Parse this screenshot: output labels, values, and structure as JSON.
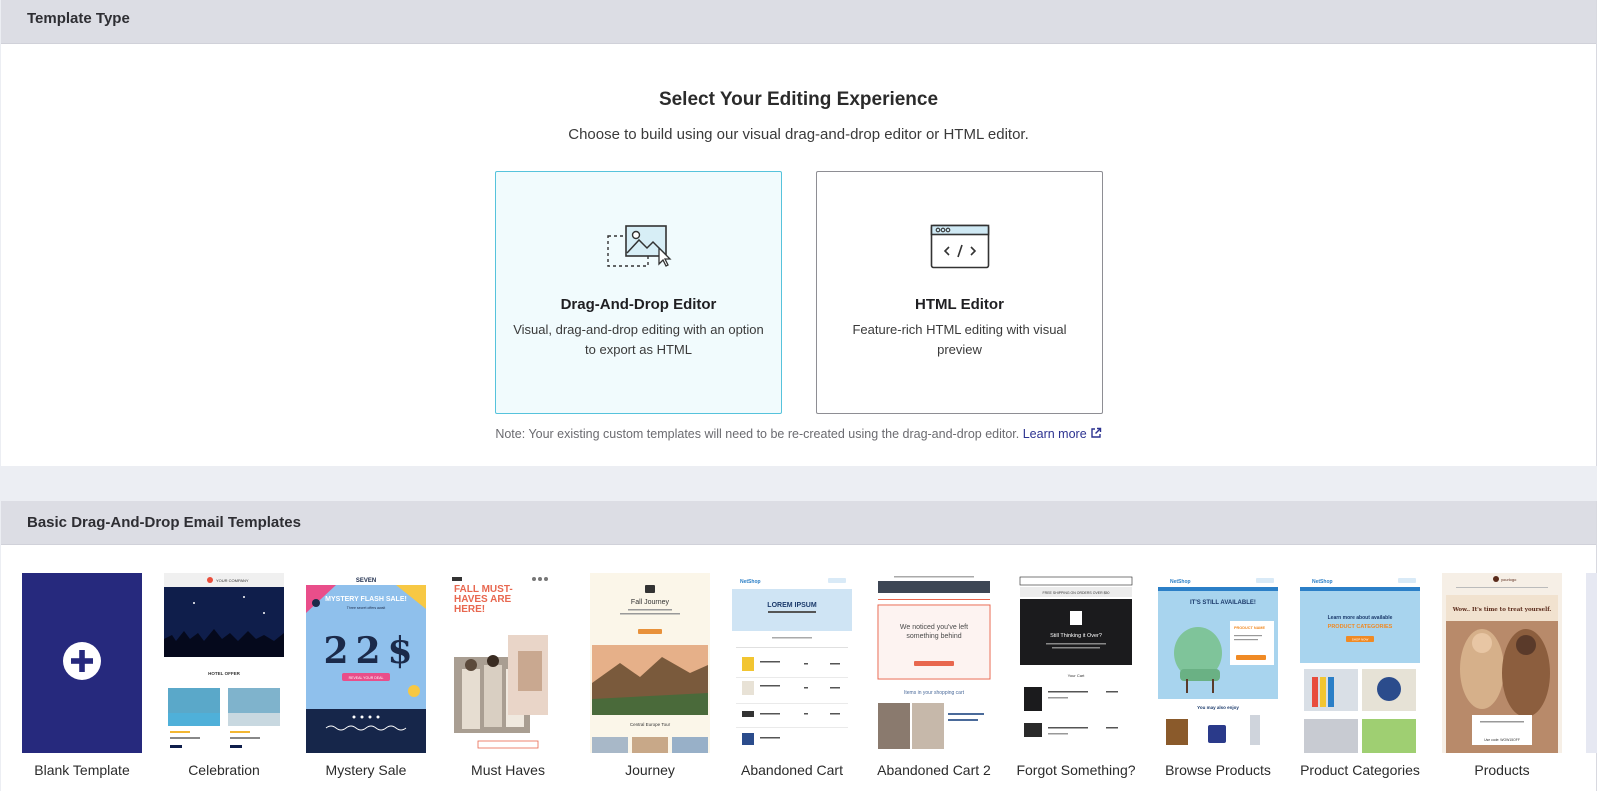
{
  "template_type": {
    "heading": "Template Type"
  },
  "editing": {
    "title": "Select Your Editing Experience",
    "subtitle": "Choose to build using our visual drag-and-drop editor or HTML editor.",
    "options": [
      {
        "title": "Drag-And-Drop Editor",
        "description": "Visual, drag-and-drop editing with an option to export as HTML",
        "selected": true
      },
      {
        "title": "HTML Editor",
        "description": "Feature-rich HTML editing with visual preview",
        "selected": false
      }
    ],
    "note": "Note: Your existing custom templates will need to be re-created using the drag-and-drop editor.",
    "learn_more": "Learn more"
  },
  "basic_templates": {
    "heading": "Basic Drag-And-Drop Email Templates",
    "items": [
      {
        "label": "Blank Template"
      },
      {
        "label": "Celebration",
        "thumb_text": [
          "YOUR COMPANY",
          "HOTEL OFFER"
        ]
      },
      {
        "label": "Mystery Sale",
        "thumb_text": [
          "SEVEN",
          "MYSTERY FLASH SALE!",
          "Three secret offers await",
          "REVEAL YOUR DEAL"
        ]
      },
      {
        "label": "Must Haves",
        "thumb_text": [
          "FALL MUST-HAVES ARE HERE!"
        ]
      },
      {
        "label": "Journey",
        "thumb_text": [
          "Fall Journey",
          "Central Europe Tour"
        ]
      },
      {
        "label": "Abandoned Cart",
        "thumb_text": [
          "NetShop",
          "LOREM IPSUM"
        ]
      },
      {
        "label": "Abandoned Cart 2",
        "thumb_text": [
          "We noticed you've left something behind",
          "Items in your shopping cart"
        ]
      },
      {
        "label": "Forgot Something?",
        "thumb_text": [
          "FREE SHIPPING ON ORDERS OVER $50",
          "Still Thinking it Over?",
          "Your Cart"
        ]
      },
      {
        "label": "Browse Products",
        "thumb_text": [
          "NetShop",
          "IT'S STILL AVAILABLE!",
          "PRODUCT NAME",
          "You may also enjoy"
        ]
      },
      {
        "label": "Product Categories",
        "thumb_text": [
          "NetShop",
          "Learn more about available",
          "PRODUCT CATEGORIES",
          "SHOP NOW"
        ]
      },
      {
        "label": "Products",
        "thumb_text": [
          "yourlogo",
          "Wow.. It's time to treat yourself.",
          "Use code: WOW15OFF"
        ]
      }
    ]
  },
  "colors": {
    "accent_blue": "#26297d",
    "selected_border": "#56c3dc",
    "selected_bg": "#f1fbfd",
    "link": "#2c3290"
  }
}
